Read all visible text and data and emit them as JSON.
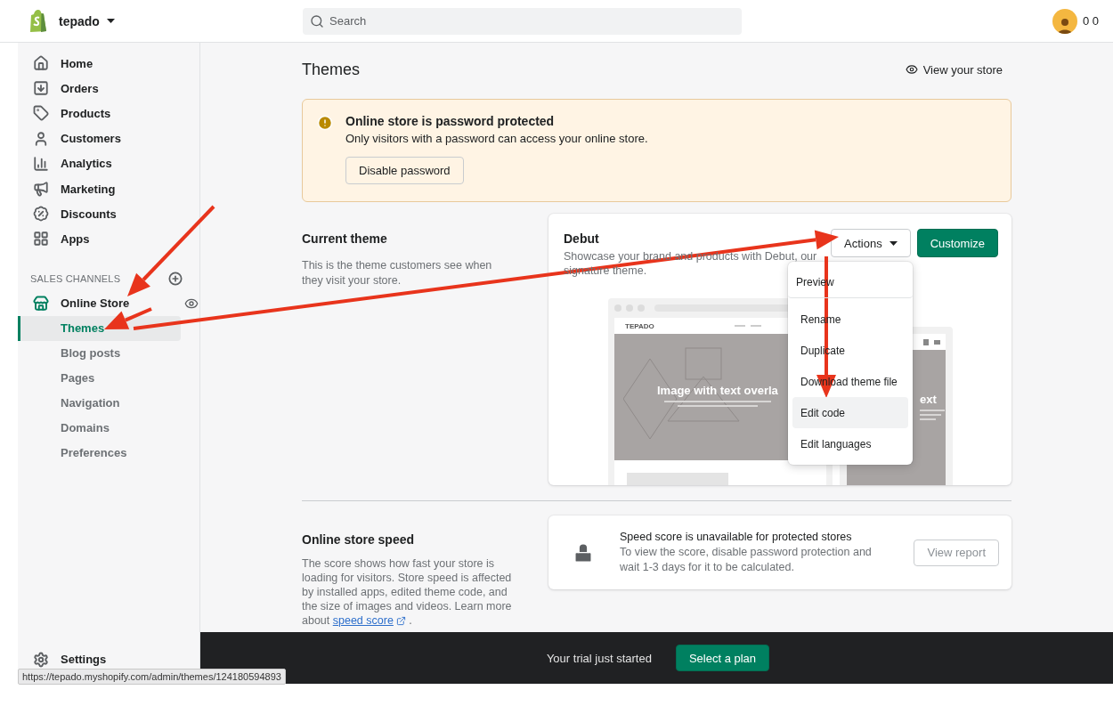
{
  "topbar": {
    "store_name": "tepado",
    "search": {
      "placeholder": "Search"
    },
    "user_initials": "0 0"
  },
  "sidebar": {
    "items": [
      {
        "label": "Home"
      },
      {
        "label": "Orders"
      },
      {
        "label": "Products"
      },
      {
        "label": "Customers"
      },
      {
        "label": "Analytics"
      },
      {
        "label": "Marketing"
      },
      {
        "label": "Discounts"
      },
      {
        "label": "Apps"
      }
    ],
    "sales_channels": {
      "heading": "SALES CHANNELS",
      "channel": {
        "label": "Online Store",
        "children": [
          {
            "label": "Themes",
            "selected": true
          },
          {
            "label": "Blog posts",
            "selected": false
          },
          {
            "label": "Pages",
            "selected": false
          },
          {
            "label": "Navigation",
            "selected": false
          },
          {
            "label": "Domains",
            "selected": false
          },
          {
            "label": "Preferences",
            "selected": false
          }
        ]
      }
    },
    "settings": "Settings"
  },
  "page": {
    "title": "Themes",
    "view_store": "View your store",
    "banner": {
      "title": "Online store is password protected",
      "text": "Only visitors with a password can access your online store.",
      "button": "Disable password"
    },
    "current_theme": {
      "heading": "Current theme",
      "description": "This is the theme customers see when they visit your store.",
      "theme_name": "Debut",
      "theme_description": "Showcase your brand and products with Debut, our signature theme.",
      "actions_button": "Actions",
      "customize_button": "Customize",
      "preview": {
        "desktop_brand": "TEPADO",
        "desktop_heading": "Image with text overla",
        "mobile_heading": "ext"
      },
      "menu": [
        {
          "label": "Preview",
          "selected": false
        },
        {
          "label": "Rename",
          "selected": false
        },
        {
          "label": "Duplicate",
          "selected": false
        },
        {
          "label": "Download theme file",
          "selected": false
        },
        {
          "label": "Edit code",
          "selected": true
        },
        {
          "label": "Edit languages",
          "selected": false
        }
      ]
    },
    "speed": {
      "heading": "Online store speed",
      "description": "The score shows how fast your store is loading for visitors. Store speed is affected by installed apps, edited theme code, and the size of images and videos. Learn more about ",
      "link": "speed score",
      "after_link": ".",
      "card_title": "Speed score is unavailable for protected stores",
      "card_text": "To view the score, disable password protection and wait 1-3 days for it to be calculated.",
      "button": {
        "label": "View report",
        "disabled": true
      }
    }
  },
  "trial_bar": {
    "text": "Your trial just started",
    "button": "Select a plan"
  },
  "status_url": "https://tepado.myshopify.com/admin/themes/124180594893"
}
